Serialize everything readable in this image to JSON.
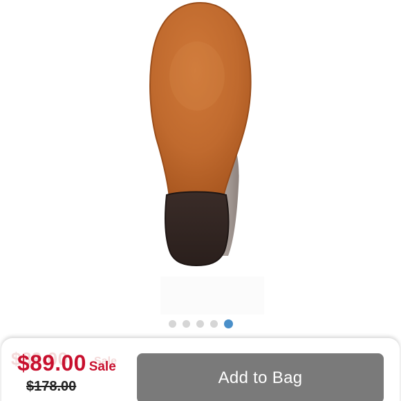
{
  "carousel": {
    "image_alt": "Shoe sole, bottom view",
    "dot_count": 5,
    "active_index": 4
  },
  "purchase_bar": {
    "sale_price": "$89.00",
    "sale_label": "Sale",
    "original_price": "$178.00",
    "add_to_bag_label": "Add to Bag",
    "ghost_price": "$89.00",
    "ghost_label": "Sale"
  },
  "colors": {
    "sale_red": "#c8102e",
    "button_gray": "#7a7a7a",
    "active_dot": "#4a8fc9",
    "inactive_dot": "#d6d6d6"
  }
}
